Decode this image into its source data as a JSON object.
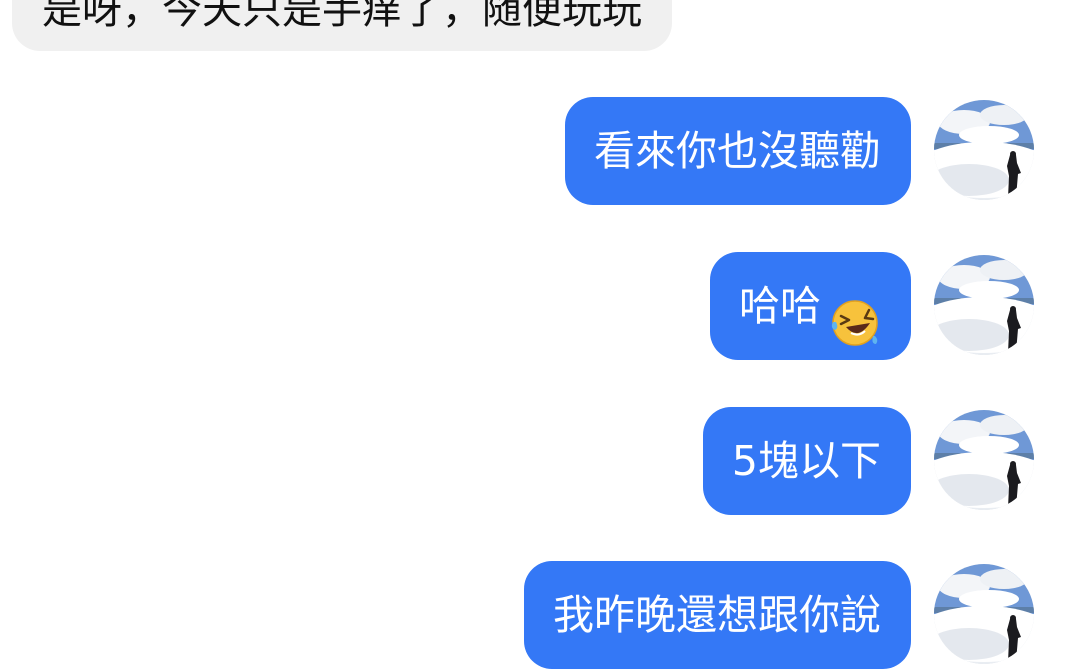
{
  "colors": {
    "outgoing_bubble": "#3478f6",
    "incoming_bubble": "#f0f0f0",
    "outgoing_text": "#ffffff",
    "incoming_text": "#111111",
    "background": "#ffffff"
  },
  "messages": {
    "incoming": [
      {
        "text": "是呀，今天只是手痒了，随便玩玩"
      }
    ],
    "outgoing": [
      {
        "text": "看來你也沒聽勸"
      },
      {
        "text": "哈哈",
        "emoji": "rolling-on-floor-laughing-emoji"
      },
      {
        "text": "5塊以下"
      },
      {
        "text": "我昨晚還想跟你說"
      }
    ]
  },
  "avatar": {
    "icon": "user-avatar-landscape"
  }
}
